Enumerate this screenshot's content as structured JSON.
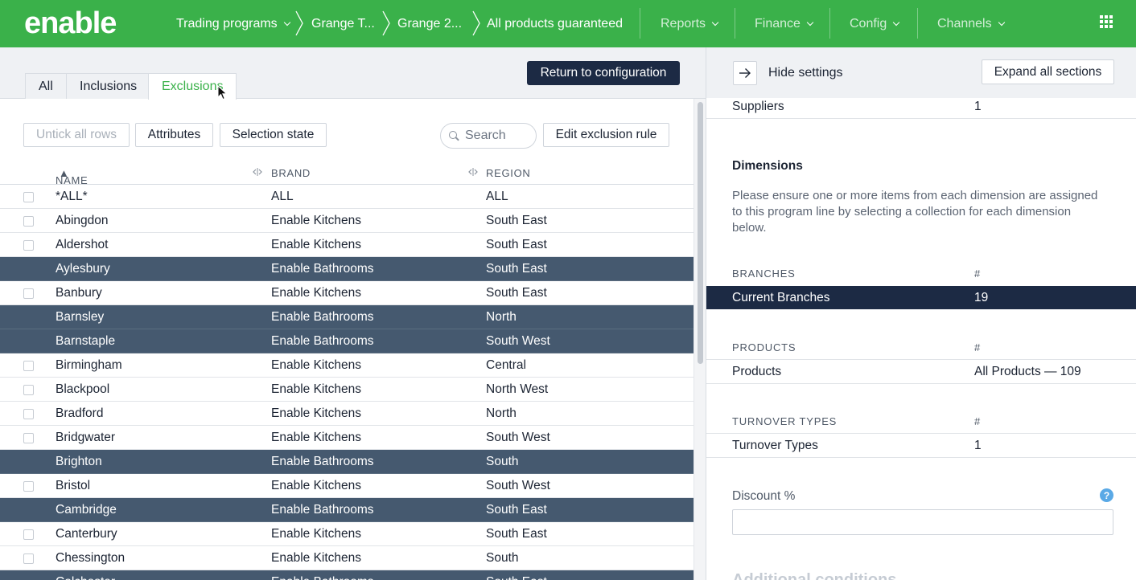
{
  "brand": {
    "logo_text": "enable",
    "primary": "#3ab14a",
    "dark": "#1c2a44",
    "selected_row": "#45596f"
  },
  "nav": {
    "trading_programs": "Trading programs",
    "crumbs": [
      "Grange T...",
      "Grange 2...",
      "All products guaranteed"
    ],
    "reports": "Reports",
    "finance": "Finance",
    "config": "Config",
    "channels": "Channels"
  },
  "tabs": [
    {
      "label": "All",
      "active": false
    },
    {
      "label": "Inclusions",
      "active": false
    },
    {
      "label": "Exclusions",
      "active": true
    }
  ],
  "actions": {
    "return": "Return to configuration",
    "untick": "Untick all rows",
    "attributes": "Attributes",
    "selection_state": "Selection state",
    "search_placeholder": "Search",
    "edit_rule": "Edit exclusion rule"
  },
  "table": {
    "columns": [
      "NAME",
      "BRAND",
      "REGION"
    ],
    "sort_indicator": "▲",
    "rows": [
      {
        "name": "*ALL*",
        "brand": "ALL",
        "region": "ALL",
        "selected": false
      },
      {
        "name": "Abingdon",
        "brand": "Enable Kitchens",
        "region": "South East",
        "selected": false
      },
      {
        "name": "Aldershot",
        "brand": "Enable Kitchens",
        "region": "South East",
        "selected": false
      },
      {
        "name": "Aylesbury",
        "brand": "Enable Bathrooms",
        "region": "South East",
        "selected": true
      },
      {
        "name": "Banbury",
        "brand": "Enable Kitchens",
        "region": "South East",
        "selected": false
      },
      {
        "name": "Barnsley",
        "brand": "Enable Bathrooms",
        "region": "North",
        "selected": true
      },
      {
        "name": "Barnstaple",
        "brand": "Enable Bathrooms",
        "region": "South West",
        "selected": true
      },
      {
        "name": "Birmingham",
        "brand": "Enable Kitchens",
        "region": "Central",
        "selected": false
      },
      {
        "name": "Blackpool",
        "brand": "Enable Kitchens",
        "region": "North West",
        "selected": false
      },
      {
        "name": "Bradford",
        "brand": "Enable Kitchens",
        "region": "North",
        "selected": false
      },
      {
        "name": "Bridgwater",
        "brand": "Enable Kitchens",
        "region": "South West",
        "selected": false
      },
      {
        "name": "Brighton",
        "brand": "Enable Bathrooms",
        "region": "South",
        "selected": true
      },
      {
        "name": "Bristol",
        "brand": "Enable Kitchens",
        "region": "South West",
        "selected": false
      },
      {
        "name": "Cambridge",
        "brand": "Enable Bathrooms",
        "region": "South East",
        "selected": true
      },
      {
        "name": "Canterbury",
        "brand": "Enable Kitchens",
        "region": "South East",
        "selected": false
      },
      {
        "name": "Chessington",
        "brand": "Enable Kitchens",
        "region": "South",
        "selected": false
      },
      {
        "name": "Colchester",
        "brand": "Enable Bathrooms",
        "region": "South East",
        "selected": true
      }
    ]
  },
  "settings": {
    "hide_label": "Hide settings",
    "expand_label": "Expand all sections",
    "suppliers_label": "Suppliers",
    "suppliers_value": "1",
    "dimensions_heading": "Dimensions",
    "dimensions_text": "Please ensure one or more items from each dimension are assigned to this program line by selecting a collection for each dimension below.",
    "branches_caption": "BRANCHES",
    "hash": "#",
    "current_branches_label": "Current Branches",
    "current_branches_value": "19",
    "products_caption": "PRODUCTS",
    "products_label": "Products",
    "products_value": "All Products — 109",
    "turnover_caption": "TURNOVER TYPES",
    "turnover_label": "Turnover Types",
    "turnover_value": "1",
    "discount_label": "Discount %",
    "help": "?",
    "cut_heading": "Additional conditions"
  }
}
